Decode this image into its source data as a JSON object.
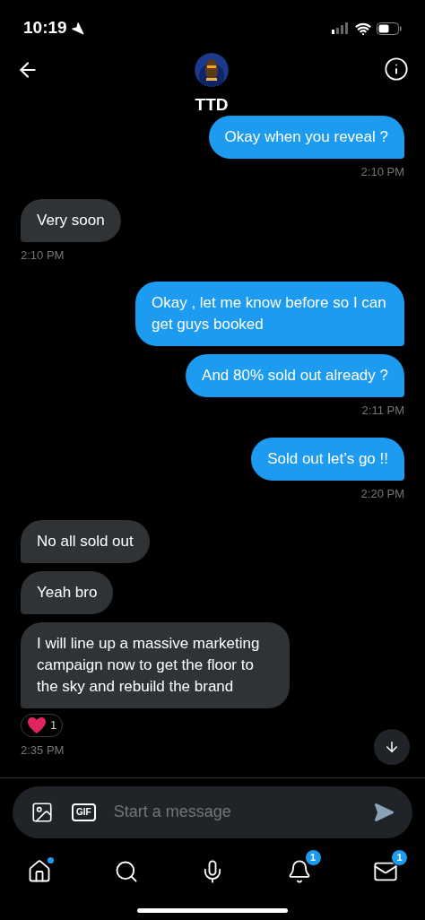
{
  "status_bar": {
    "time": "10:19"
  },
  "header": {
    "name": "TTD"
  },
  "messages": [
    {
      "kind": "sent",
      "text": "Okay when you reveal ?",
      "time": "2:10 PM"
    },
    {
      "kind": "received",
      "text": "Very soon",
      "time": "2:10 PM"
    },
    {
      "kind": "sent",
      "text": "Okay , let me know before so I can get guys booked"
    },
    {
      "kind": "sent",
      "text": "And 80% sold out already ?",
      "time": "2:11 PM"
    },
    {
      "kind": "sent",
      "text": "Sold out let’s go !!",
      "time": "2:20 PM"
    },
    {
      "kind": "received",
      "text": "No all sold out"
    },
    {
      "kind": "received",
      "text": "Yeah bro"
    },
    {
      "kind": "received",
      "text": "I will line up a massive marketing campaign now to get the floor to the sky and rebuild the brand",
      "reaction": {
        "count": "1"
      },
      "time": "2:35 PM"
    }
  ],
  "composer": {
    "gif_label": "GIF",
    "placeholder": "Start a message"
  },
  "nav": [
    {
      "kind": "home",
      "dot": true
    },
    {
      "kind": "search"
    },
    {
      "kind": "spaces"
    },
    {
      "kind": "notifications",
      "badge": "1"
    },
    {
      "kind": "messages",
      "badge": "1"
    }
  ]
}
